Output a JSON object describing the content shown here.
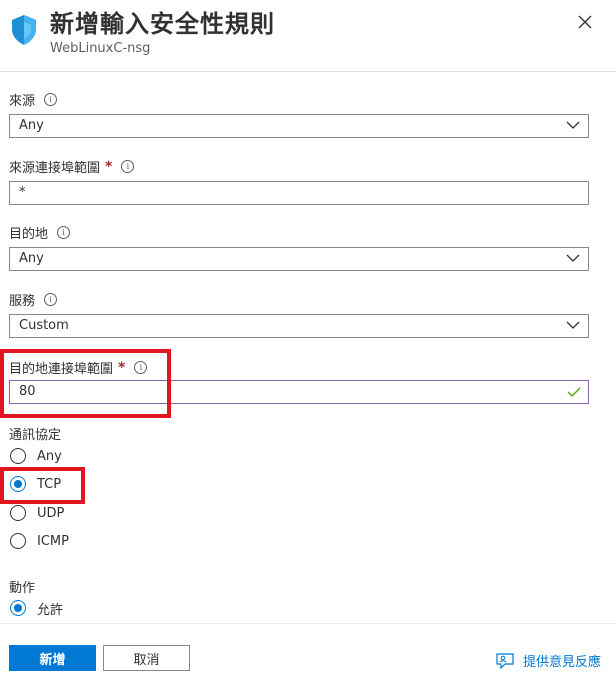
{
  "header": {
    "title": "新增輸入安全性規則",
    "subtitle": "WebLinuxC-nsg"
  },
  "form": {
    "source": {
      "label": "來源",
      "value": "Any"
    },
    "source_port": {
      "label": "來源連接埠範圍",
      "required": "*",
      "value": "*"
    },
    "destination": {
      "label": "目的地",
      "value": "Any"
    },
    "service": {
      "label": "服務",
      "value": "Custom"
    },
    "dest_port": {
      "label": "目的地連接埠範圍",
      "required": "*",
      "value": "80"
    },
    "protocol": {
      "label": "通訊協定",
      "options": [
        "Any",
        "TCP",
        "UDP",
        "ICMP"
      ],
      "selected": "TCP"
    },
    "action": {
      "label": "動作",
      "options": [
        "允許"
      ],
      "selected": "允許"
    }
  },
  "footer": {
    "add_label": "新增",
    "cancel_label": "取消",
    "feedback_label": "提供意見反應"
  },
  "colors": {
    "accent": "#0078d4",
    "highlight": "#e3161f",
    "required": "#a4262c",
    "valid": "#57a300"
  }
}
